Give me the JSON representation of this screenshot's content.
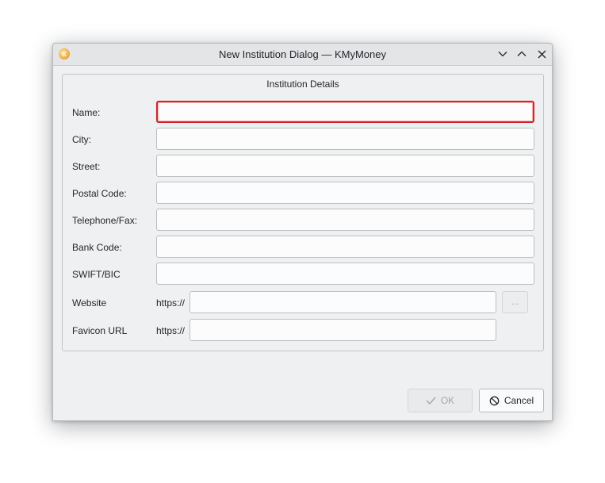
{
  "window": {
    "title": "New Institution Dialog — KMyMoney",
    "app_icon_glyph": "K"
  },
  "colors": {
    "focus_border": "#da2128",
    "window_bg": "#eff0f1"
  },
  "group": {
    "title": "Institution Details"
  },
  "fields": {
    "name": {
      "label": "Name:",
      "value": ""
    },
    "city": {
      "label": "City:",
      "value": ""
    },
    "street": {
      "label": "Street:",
      "value": ""
    },
    "postal_code": {
      "label": "Postal Code:",
      "value": ""
    },
    "telephone": {
      "label": "Telephone/Fax:",
      "value": ""
    },
    "bank_code": {
      "label": "Bank Code:",
      "value": ""
    },
    "swift": {
      "label": "SWIFT/BIC",
      "value": ""
    },
    "website": {
      "label": "Website",
      "prefix": "https://",
      "value": ""
    },
    "favicon": {
      "label": "Favicon URL",
      "prefix": "https://",
      "value": ""
    }
  },
  "browse_button": {
    "label": "..."
  },
  "buttons": {
    "ok": {
      "label": "OK",
      "icon": "check-icon",
      "enabled": false
    },
    "cancel": {
      "label": "Cancel",
      "icon": "cancel-icon",
      "enabled": true
    }
  },
  "titlebar_buttons": [
    "chevron-down-icon",
    "chevron-up-icon",
    "close-icon"
  ]
}
